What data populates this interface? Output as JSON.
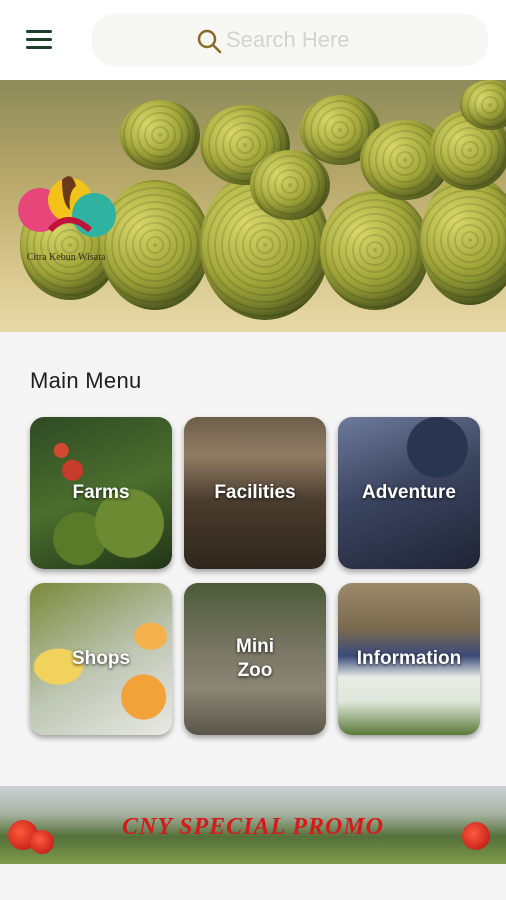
{
  "header": {
    "search": {
      "placeholder": "Search Here",
      "value": ""
    }
  },
  "banner": {
    "logo_caption": "Citra Kebun Wisata"
  },
  "main_menu": {
    "title": "Main Menu",
    "tiles": [
      {
        "label": "Farms"
      },
      {
        "label": "Facilities"
      },
      {
        "label": "Adventure"
      },
      {
        "label": "Shops"
      },
      {
        "label": "Mini\nZoo"
      },
      {
        "label": "Information"
      }
    ]
  },
  "promo": {
    "text": "CNY SPECIAL PROMO"
  },
  "colors": {
    "menu_icon": "#1f3d2b",
    "search_icon": "#8a6a2a",
    "promo_text": "#d41a1a"
  }
}
